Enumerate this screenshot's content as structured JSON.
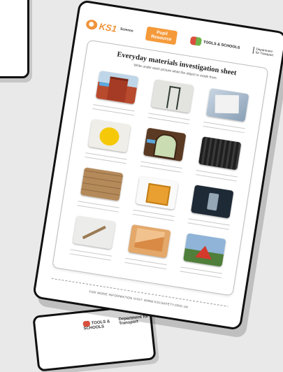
{
  "sheet": {
    "brand": "KS1",
    "brand_sub": "Science",
    "badge": "Pupil Resource",
    "tools_logo": "TOOLS & SCHOOLS",
    "dept_logo": "Department for Transport",
    "title": "Everyday materials investigation sheet",
    "subtitle": "Write under each picture what the object is made from.",
    "footer": "FOR MORE INFORMATION VISIT: WWW.KS1SAFETY.ORG.UK",
    "items": [
      {
        "icon": "house-photo"
      },
      {
        "icon": "chair-photo"
      },
      {
        "icon": "newspaper-photo"
      },
      {
        "icon": "rubber-duck-photo"
      },
      {
        "icon": "window-photo"
      },
      {
        "icon": "tyre-photo"
      },
      {
        "icon": "stone-wall-photo"
      },
      {
        "icon": "cardboard-box-photo"
      },
      {
        "icon": "glass-photo"
      },
      {
        "icon": "pencil-photo"
      },
      {
        "icon": "envelope-photo"
      },
      {
        "icon": "tent-photo"
      }
    ]
  },
  "back_card": {
    "tools_logo": "TOOLS & SCHOOLS",
    "dept_logo": "Department for Transport"
  },
  "colors": {
    "accent": "#f59a3a",
    "outline": "#111111",
    "background": "#e9e9e9"
  }
}
